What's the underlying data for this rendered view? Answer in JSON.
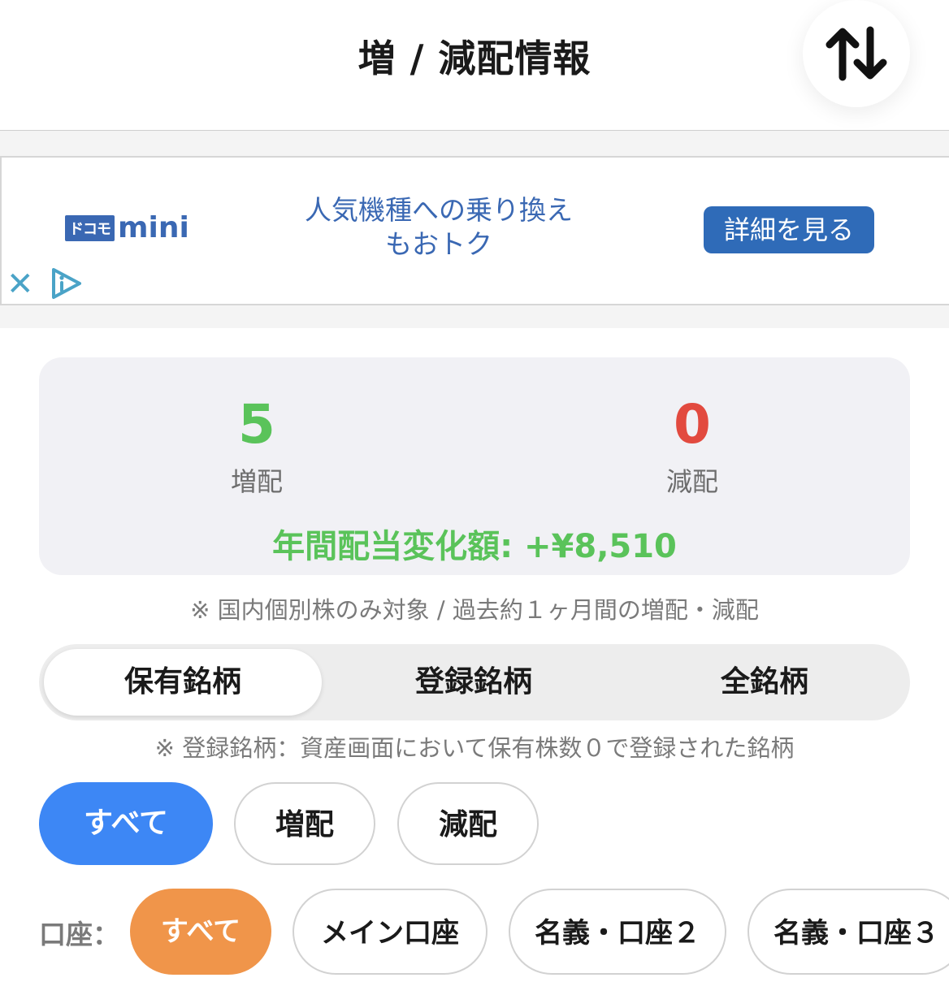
{
  "header": {
    "title": "増 / 減配情報",
    "sort_icon": "up-down-arrows-icon"
  },
  "ad": {
    "logo_box": "ドコモ",
    "logo_text": "mini",
    "text_line1": "人気機種への乗り換え",
    "text_line2": "もおトク",
    "cta": "詳細を見る",
    "close_icon": "close-icon",
    "info_icon": "ad-choices-icon"
  },
  "summary": {
    "increase_count": "5",
    "increase_label": "増配",
    "decrease_count": "0",
    "decrease_label": "減配",
    "annual_change": "年間配当変化額: +¥8,510",
    "increase_color": "#5ac35a",
    "decrease_color": "#e24a3f"
  },
  "notes": {
    "scope": "※ 国内個別株のみ対象 / 過去約１ヶ月間の増配・減配",
    "registered": "※ 登録銘柄：資産画面において保有株数０で登録された銘柄"
  },
  "segments": {
    "items": [
      "保有銘柄",
      "登録銘柄",
      "全銘柄"
    ],
    "selected": "保有銘柄"
  },
  "filters": {
    "items": [
      "すべて",
      "増配",
      "減配"
    ],
    "selected": "すべて",
    "accent": "#3d87f5"
  },
  "accounts": {
    "label": "口座：",
    "items": [
      "すべて",
      "メイン口座",
      "名義・口座２",
      "名義・口座３"
    ],
    "selected": "すべて",
    "accent": "#f0954a"
  }
}
